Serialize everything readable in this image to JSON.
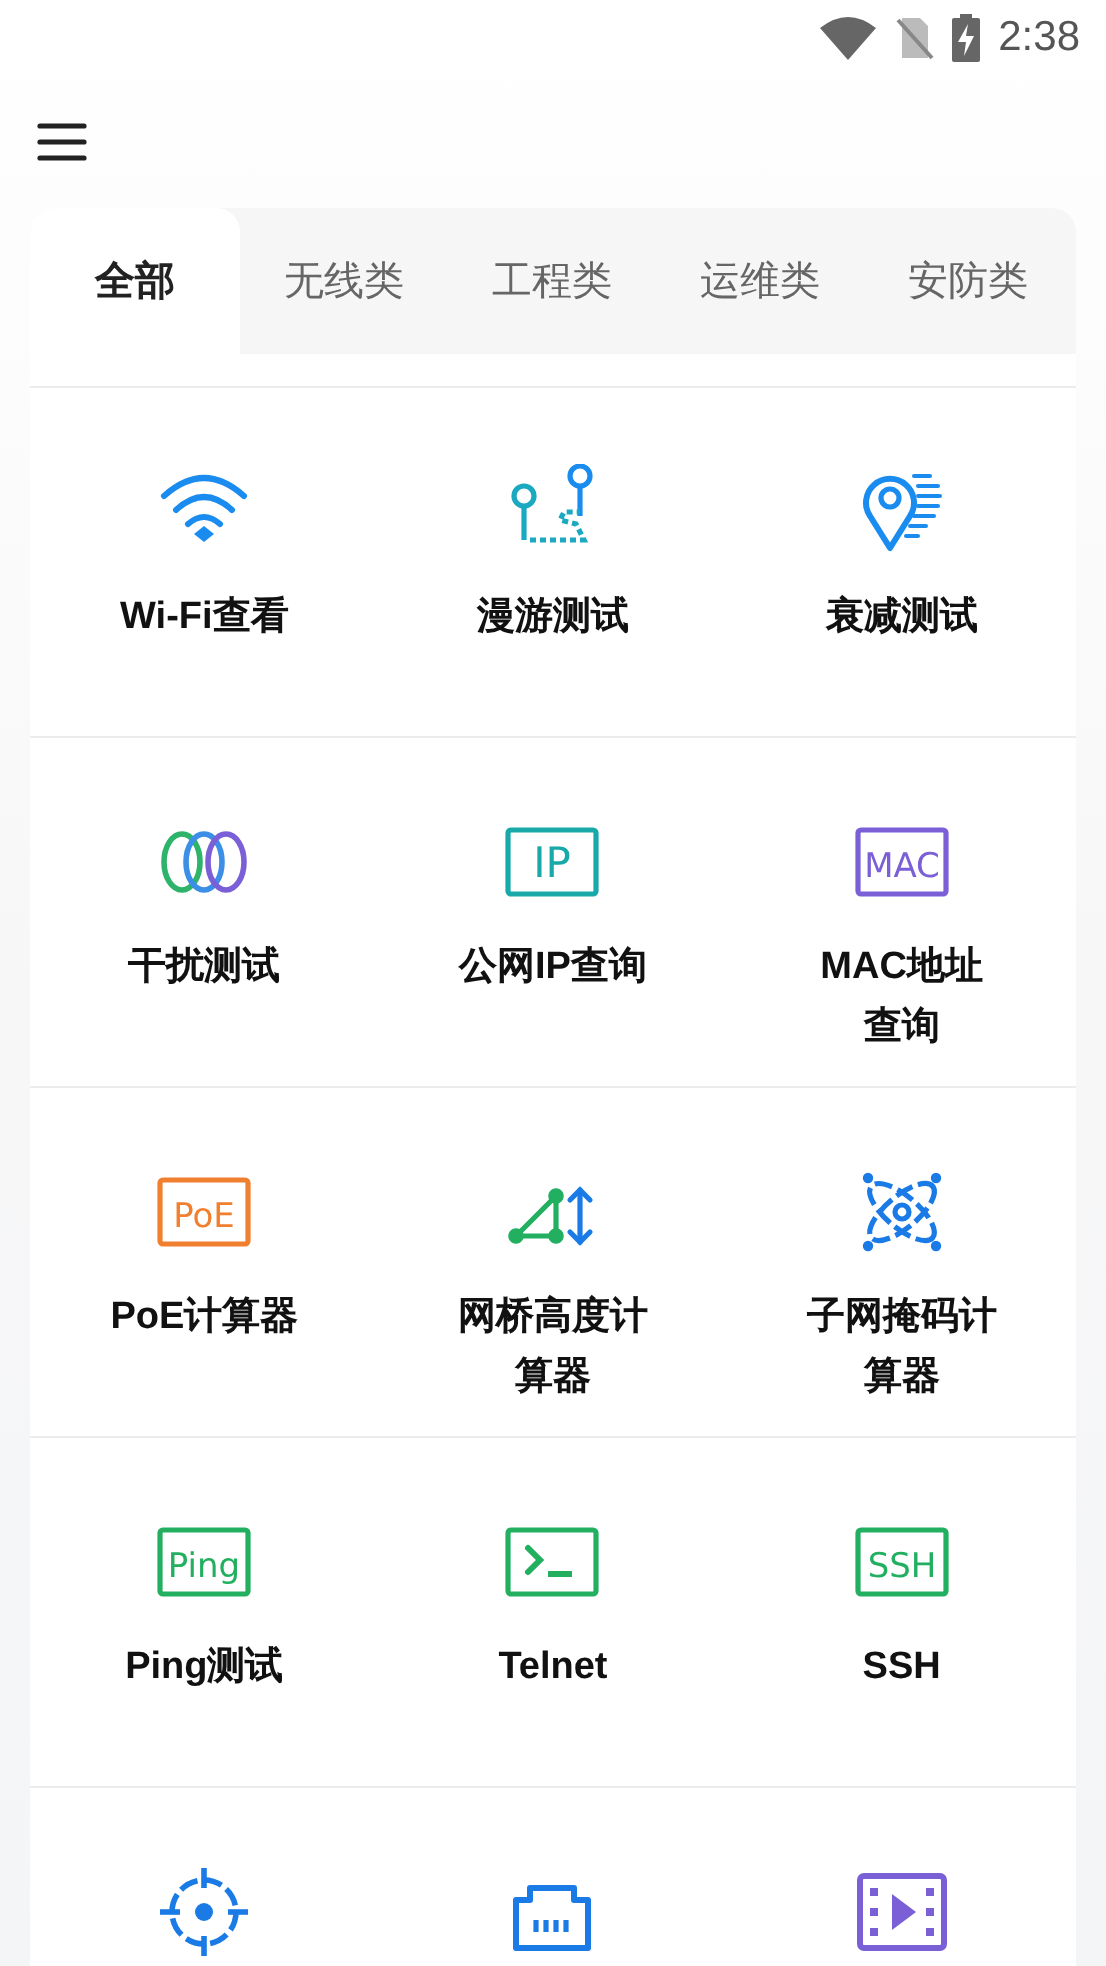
{
  "status_bar": {
    "time": "2:38"
  },
  "tabs": [
    {
      "label": "全部",
      "selected": true
    },
    {
      "label": "无线类",
      "selected": false
    },
    {
      "label": "工程类",
      "selected": false
    },
    {
      "label": "运维类",
      "selected": false
    },
    {
      "label": "安防类",
      "selected": false
    }
  ],
  "tools": [
    {
      "label": "Wi-Fi查看",
      "kind": "wifi",
      "color": "#1a8cf0"
    },
    {
      "label": "漫游测试",
      "kind": "route",
      "color": "#1aa9c0"
    },
    {
      "label": "衰减测试",
      "kind": "pin",
      "color": "#1a8cf0"
    },
    {
      "label": "干扰测试",
      "kind": "rings",
      "color": "#3b8fe6"
    },
    {
      "label": "公网IP查询",
      "kind": "badge",
      "badge": "IP",
      "color": "#1aa9a9"
    },
    {
      "label": "MAC地址查询",
      "kind": "badge",
      "badge": "MAC",
      "color": "#7b5fd6"
    },
    {
      "label": "PoE计算器",
      "kind": "badge",
      "badge": "PoE",
      "color": "#f08030"
    },
    {
      "label": "网桥高度计算器",
      "kind": "height",
      "color": "#22b060"
    },
    {
      "label": "子网掩码计算器",
      "kind": "atom",
      "color": "#1a7ae6"
    },
    {
      "label": "Ping测试",
      "kind": "badge",
      "badge": "Ping",
      "color": "#22b060"
    },
    {
      "label": "Telnet",
      "kind": "terminal",
      "color": "#22b060"
    },
    {
      "label": "SSH",
      "kind": "badge",
      "badge": "SSH",
      "color": "#22b060"
    },
    {
      "kind": "target",
      "color": "#1a7ae6"
    },
    {
      "kind": "port",
      "color": "#1a7ae6"
    },
    {
      "kind": "video",
      "color": "#7b5fd6"
    }
  ]
}
